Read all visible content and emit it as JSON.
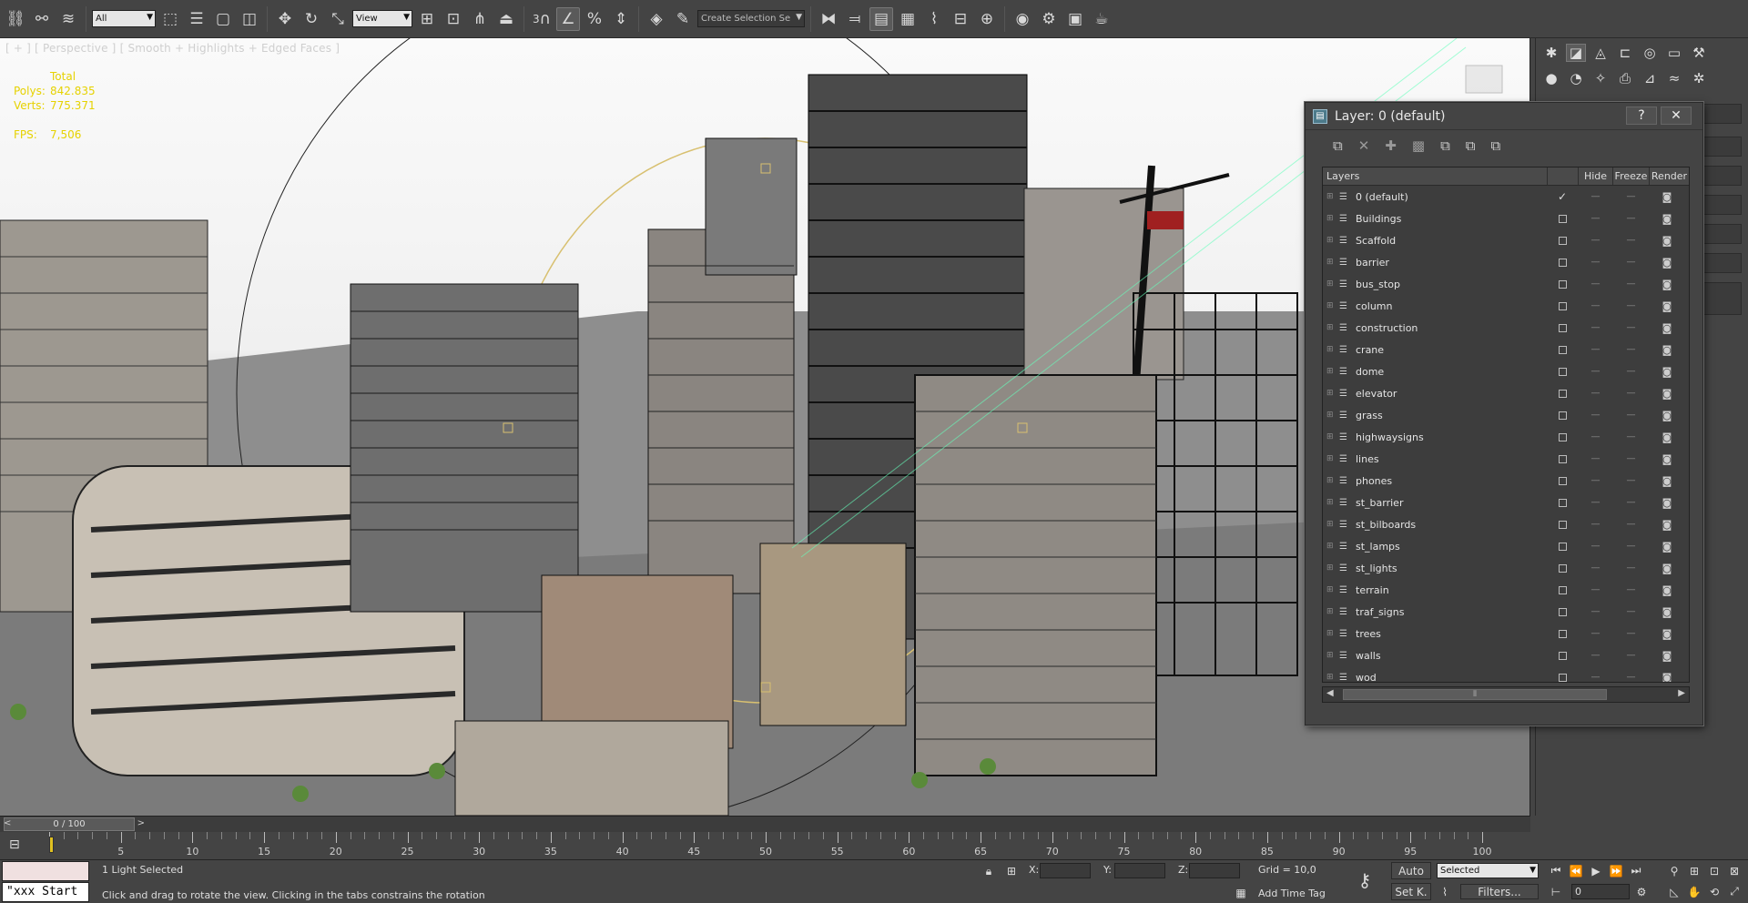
{
  "toolbar": {
    "selection_filter": "All",
    "ref_coord": "View",
    "selection_set_placeholder": "Create Selection Se",
    "snap_label": "3",
    "icons": [
      "link-icon",
      "unlink-icon",
      "bind-spacewarp-icon",
      "select-icon",
      "select-by-name-icon",
      "rect-selection-icon",
      "window-crossing-icon",
      "move-icon",
      "rotate-icon",
      "scale-icon",
      "pivot-icon",
      "manipulate-icon",
      "keyboard-shortcut-icon",
      "snap-icon",
      "angle-snap-icon",
      "percent-snap-icon",
      "spinner-snap-icon",
      "edit-named-sets-icon",
      "mirror-icon",
      "align-icon",
      "layer-manager-icon",
      "scene-explorer-icon",
      "curve-editor-icon",
      "schematic-view-icon",
      "material-editor-icon",
      "render-setup-icon",
      "rendered-frame-icon",
      "render-icon"
    ]
  },
  "viewport": {
    "label": "[ + ] [ Perspective ] [ Smooth + Highlights + Edged Faces ]",
    "stats": {
      "total_label": "Total",
      "polys_label": "Polys:",
      "polys_value": "842.835",
      "verts_label": "Verts:",
      "verts_value": "775.371",
      "fps_label": "FPS:",
      "fps_value": "7,506"
    }
  },
  "layer_manager": {
    "title": "Layer: 0 (default)",
    "help_button": "?",
    "close_button": "✕",
    "columns": {
      "name": "Layers",
      "hide": "Hide",
      "freeze": "Freeze",
      "render": "Render"
    },
    "layers": [
      {
        "name": "0 (default)",
        "current": true
      },
      {
        "name": "Buildings",
        "current": false
      },
      {
        "name": "Scaffold",
        "current": false
      },
      {
        "name": "barrier",
        "current": false
      },
      {
        "name": "bus_stop",
        "current": false
      },
      {
        "name": "column",
        "current": false
      },
      {
        "name": "construction",
        "current": false
      },
      {
        "name": "crane",
        "current": false
      },
      {
        "name": "dome",
        "current": false
      },
      {
        "name": "elevator",
        "current": false
      },
      {
        "name": "grass",
        "current": false
      },
      {
        "name": "highwaysigns",
        "current": false
      },
      {
        "name": "lines",
        "current": false
      },
      {
        "name": "phones",
        "current": false
      },
      {
        "name": "st_barrier",
        "current": false
      },
      {
        "name": "st_bilboards",
        "current": false
      },
      {
        "name": "st_lamps",
        "current": false
      },
      {
        "name": "st_lights",
        "current": false
      },
      {
        "name": "terrain",
        "current": false
      },
      {
        "name": "traf_signs",
        "current": false
      },
      {
        "name": "trees",
        "current": false
      },
      {
        "name": "walls",
        "current": false
      },
      {
        "name": "wod",
        "current": false
      }
    ]
  },
  "timeline": {
    "frame_display": "0 / 100",
    "prev": "<",
    "next": ">",
    "tick_labels": [
      "0",
      "5",
      "10",
      "15",
      "20",
      "25",
      "30",
      "35",
      "40",
      "45",
      "50",
      "55",
      "60",
      "65",
      "70",
      "75",
      "80",
      "85",
      "90",
      "95",
      "100"
    ]
  },
  "status": {
    "maxscript_text": "\"xxx Start",
    "selection_info": "1 Light Selected",
    "prompt": "Click and drag to rotate the view.  Clicking in the tabs constrains the rotation",
    "x_label": "X:",
    "y_label": "Y:",
    "z_label": "Z:",
    "grid": "Grid = 10,0",
    "add_time_tag": "Add Time Tag",
    "auto_key": "Auto",
    "set_key": "Set K.",
    "key_filter_value": "Selected",
    "filters": "Filters...",
    "frame_value": "0"
  },
  "colors": {
    "ui_bg": "#444444",
    "stats_yellow": "#e6d200",
    "time_key": "#e0c020"
  }
}
